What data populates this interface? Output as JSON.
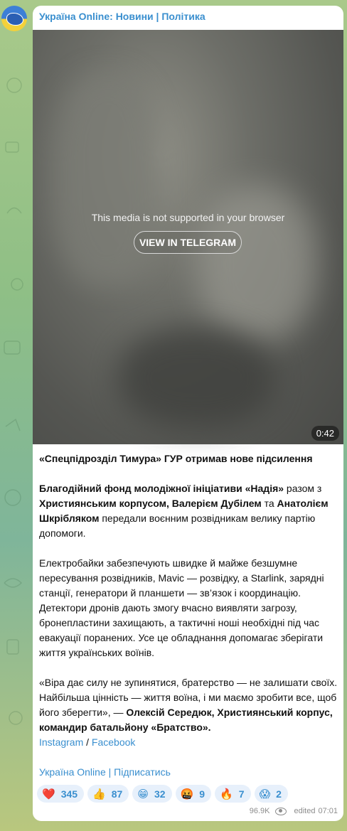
{
  "channel": {
    "name": "Україна Online: Новини | Політика"
  },
  "media": {
    "unsupported_text": "This media is not supported in your browser",
    "view_button": "VIEW IN TELEGRAM",
    "duration": "0:42"
  },
  "post": {
    "headline": "«Спецпідрозділ Тимура» ГУР отримав нове підсилення",
    "p2": {
      "b1": "Благодійний фонд молодіжної ініціативи «Надія»",
      "t1": " разом з ",
      "b2": "Християнським корпусом, Валерієм Дубілем",
      "t2": " та ",
      "b3": "Анатолієм Шкрібляком",
      "t3": " передали воєнним розвідникам велику партію допомоги."
    },
    "p3": "Електробайки забезпечують швидке й майже безшумне пересування розвідників, Mavic — розвідку, а Starlink, зарядні станції, генератори й планшети — зв’язок і координацію. Детектори дронів дають змогу вчасно виявляти загрозу, бронепластини захищають, а тактичні ноші необхідні під час евакуації поранених. Усе це обладнання допомагає зберігати життя українських воїнів.",
    "p4": {
      "t1": "«Віра дає силу не зупинятися, братерство — не залишати своїх. Найбільша цінність — життя воїна, і ми маємо зробити все, щоб його зберегти», — ",
      "b1": "Олексій Середюк, Християнський корпус, командир батальйону «Братство»."
    },
    "links": {
      "instagram": "Instagram",
      "separator": " / ",
      "facebook": "Facebook"
    },
    "subscribe": "Україна Online | Підписатись"
  },
  "reactions": [
    {
      "emoji": "❤️",
      "icon": "heart-icon",
      "count": "345"
    },
    {
      "emoji": "👍",
      "icon": "thumbs-up-icon",
      "count": "87"
    },
    {
      "emoji": "😁",
      "icon": "grin-icon",
      "count": "32"
    },
    {
      "emoji": "🤬",
      "icon": "angry-icon",
      "count": "9"
    },
    {
      "emoji": "🔥",
      "icon": "fire-icon",
      "count": "7"
    },
    {
      "emoji": "😱",
      "icon": "scream-icon",
      "count": "2"
    }
  ],
  "meta": {
    "views": "96.9K",
    "edited": "edited",
    "time": "07:01"
  },
  "colors": {
    "accent": "#3a8fcf",
    "reaction_bg": "#e7f0fb"
  }
}
